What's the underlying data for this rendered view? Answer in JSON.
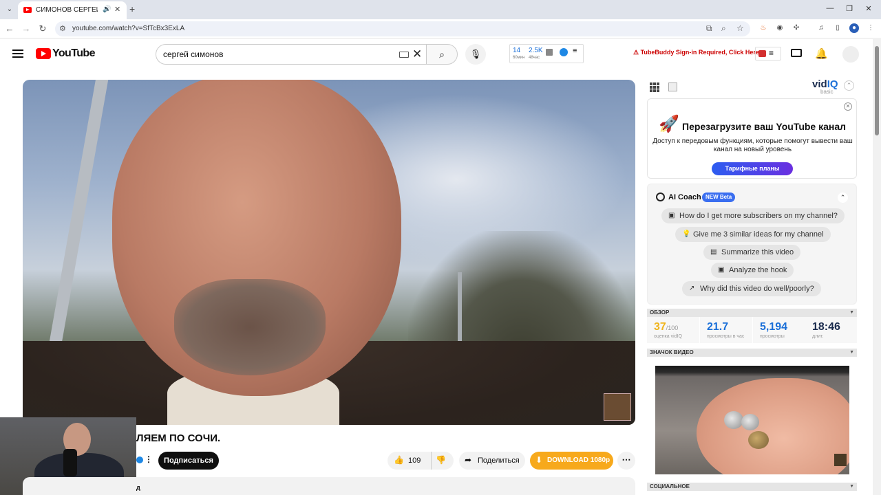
{
  "browser": {
    "tab_title": "СИМОНОВ СЕРГЕЙ - ГУЛЯ",
    "url": "youtube.com/watch?v=SfTcBx3ExLA"
  },
  "masthead": {
    "logo_text": "YouTube",
    "search_value": "сергей симонов",
    "stats_widget": {
      "value_1": "14",
      "label_1": "60мин",
      "value_2": "2.5K",
      "label_2": "48час"
    },
    "tubebuddy_text": "TubeBuddy Sign-in Required, Click Here"
  },
  "video": {
    "title_visible": "ЛЯЕМ ПО СОЧИ.",
    "subscribe_label": "Подписаться",
    "like_count": "109",
    "share_label": "Поделиться",
    "download_label": "DOWNLOAD 1080p",
    "description_fragment": "д"
  },
  "vidiq": {
    "logo_prefix": "vid",
    "logo_suffix": "IQ",
    "plan": "basic",
    "promo": {
      "title": "Перезагрузите ваш YouTube канал",
      "text": "Доступ к передовым функциям, которые помогут вывести ваш канал на новый уровень",
      "button": "Тарифные планы"
    },
    "ai_coach": {
      "title": "AI Coach",
      "badge": "NEW Beta",
      "chips": [
        "How do I get more subscribers on my channel?",
        "Give me 3 similar ideas for my channel",
        "Summarize this video",
        "Analyze the hook",
        "Why did this video do well/poorly?"
      ]
    },
    "overview": {
      "section_label": "ОБЗОР",
      "score": "37",
      "score_max": "/100",
      "score_label": "оценка vidIQ",
      "views_per_hour": "21.7",
      "views_per_hour_label": "просмотры в час",
      "views": "5,194",
      "views_label": "просмотры",
      "duration": "18:46",
      "duration_label": "длит."
    },
    "thumbnail_section_label": "ЗНАЧОК ВИДЕО",
    "social_section_label": "СОЦИАЛЬНОЕ"
  },
  "icons": {
    "search": "search-icon",
    "mic": "mic-icon",
    "bell": "bell-icon",
    "create": "create-icon",
    "rocket": "rocket-icon"
  },
  "colors": {
    "youtube_red": "#ff0000",
    "download_orange": "#f7a91c",
    "vidiq_blue": "#1a6fd8",
    "coach_badge": "#3a6ef0",
    "score_yellow": "#f0b41c"
  }
}
